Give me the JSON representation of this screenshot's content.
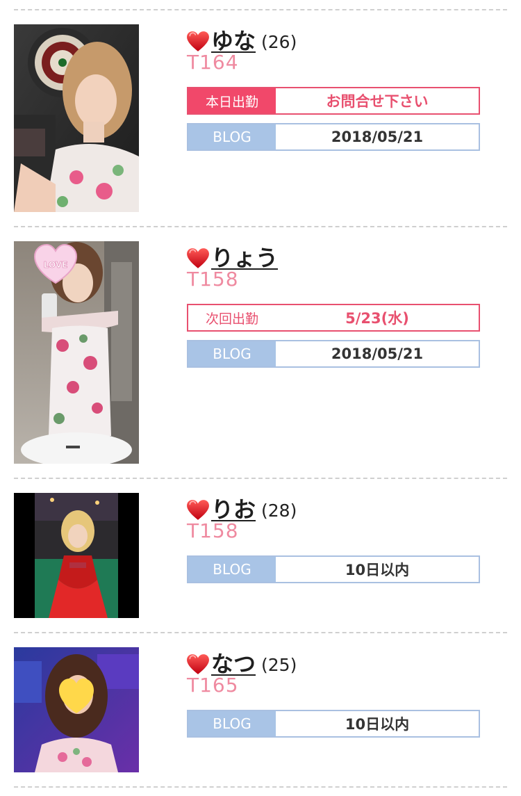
{
  "colors": {
    "accent_pink": "#f1486a",
    "height_pink": "#ef8aa0",
    "blog_blue": "#a9c4e6",
    "divider": "#cfcfcf"
  },
  "girls": [
    {
      "name": "ゆな",
      "age": "(26)",
      "height": "T164",
      "schedule": {
        "label": "本日出勤",
        "value": "お問合せ下さい",
        "style": "today"
      },
      "blog": {
        "label": "BLOG",
        "value": "2018/05/21"
      },
      "photo_icon": "heart-icon"
    },
    {
      "name": "りょう",
      "age": "",
      "height": "T158",
      "schedule": {
        "label": "次回出勤",
        "value": "5/23(水)",
        "style": "next"
      },
      "blog": {
        "label": "BLOG",
        "value": "2018/05/21"
      },
      "photo_icon": "heart-icon"
    },
    {
      "name": "りお",
      "age": "(28)",
      "height": "T158",
      "blog": {
        "label": "BLOG",
        "value": "10日以内"
      },
      "photo_icon": "heart-icon"
    },
    {
      "name": "なつ",
      "age": "(25)",
      "height": "T165",
      "blog": {
        "label": "BLOG",
        "value": "10日以内"
      },
      "photo_icon": "heart-icon"
    }
  ],
  "photo_overlays": {
    "girl1": "LOVE"
  }
}
